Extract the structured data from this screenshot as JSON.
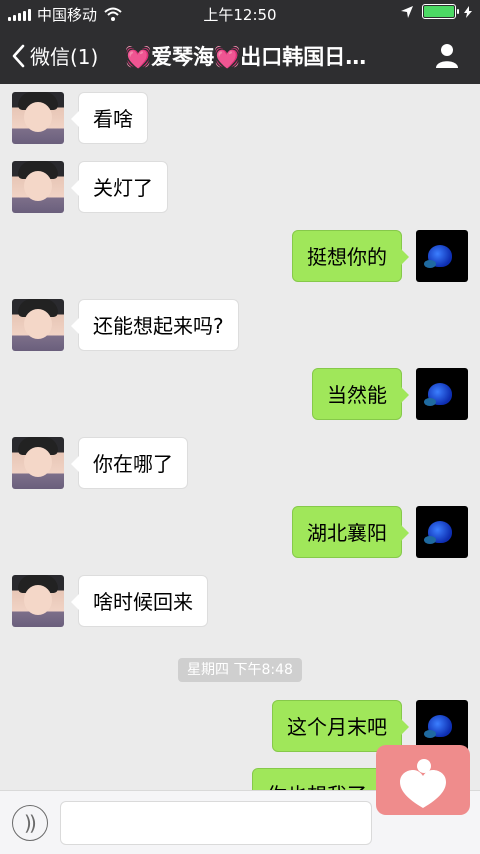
{
  "status": {
    "carrier": "中国移动",
    "time": "上午12:50"
  },
  "nav": {
    "back_label": "微信(1)",
    "title": "💓爱琴海💓出口韩国日…"
  },
  "messages": [
    {
      "side": "left",
      "text": "看啥"
    },
    {
      "side": "left",
      "text": "关灯了"
    },
    {
      "side": "right",
      "text": "挺想你的"
    },
    {
      "side": "left",
      "text": "还能想起来吗?"
    },
    {
      "side": "right",
      "text": "当然能"
    },
    {
      "side": "left",
      "text": "你在哪了"
    },
    {
      "side": "right",
      "text": "湖北襄阳"
    },
    {
      "side": "left",
      "text": "啥时候回来"
    },
    {
      "type": "timestamp",
      "text": "星期四 下午8:48"
    },
    {
      "side": "right",
      "text": "这个月末吧"
    },
    {
      "side": "right",
      "text": "你也想我了"
    }
  ],
  "icons": {
    "back": "chevron-left-icon",
    "profile": "person-icon",
    "voice": "voice-icon",
    "sticker": "heart-sticker-icon",
    "wifi": "wifi-icon",
    "location": "location-arrow-icon",
    "battery": "battery-icon"
  },
  "colors": {
    "topbar": "#2e2e30",
    "chat_bg": "#ebebeb",
    "bubble_left": "#ffffff",
    "bubble_right": "#a0e75a",
    "timestamp_bg": "#cfcfcf",
    "battery": "#4cd964",
    "sticker": "#ef8c8c"
  }
}
